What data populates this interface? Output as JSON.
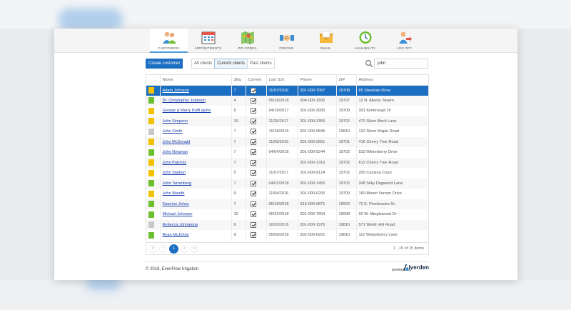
{
  "nav": [
    {
      "label": "CUSTOMERS",
      "icon": "customers-icon",
      "active": true
    },
    {
      "label": "APPOINTMENTS",
      "icon": "appointments-icon",
      "active": false
    },
    {
      "label": "ZIP-CODES",
      "icon": "map-icon",
      "active": false
    },
    {
      "label": "PRICING",
      "icon": "handshake-icon",
      "active": false
    },
    {
      "label": "EMAIL",
      "icon": "envelope-icon",
      "active": false
    },
    {
      "label": "AVAILIBILITY",
      "icon": "clock-icon",
      "active": false
    },
    {
      "label": "LOG OFF",
      "icon": "logoff-icon",
      "active": false
    }
  ],
  "toolbar": {
    "create_label": "Create customer",
    "filters": [
      "All clients",
      "Current clients",
      "Past clients"
    ],
    "active_filter": "Current clients",
    "search_value": "john"
  },
  "table": {
    "columns": [
      "",
      "Name",
      "ZEq",
      "Current",
      "Last Sch.",
      "Phone",
      "ZIP",
      "Address"
    ],
    "rows": [
      {
        "color": "#f2c200",
        "name": "Adam Johnson",
        "zeq": "7",
        "current": true,
        "last": "11/07/2016",
        "phone": "301-000-7067",
        "zip": "19708",
        "address": "85 Sheehan Drive",
        "selected": true
      },
      {
        "color": "#6cbf2e",
        "name": "Dr. Christopher Johnson",
        "zeq": "4",
        "current": true,
        "last": "05/16/2018",
        "phone": "904-000-1832",
        "zip": "19707",
        "address": "12 N. Aikens Tavern"
      },
      {
        "color": "#f2c200",
        "name": "George & Marry Ruffl ejohn",
        "zeq": "5",
        "current": true,
        "last": "04/19/2017",
        "phone": "301-000-3006",
        "zip": "19709",
        "address": "301 Kimbrough Dr"
      },
      {
        "color": "#f2c200",
        "name": "John Simpson",
        "zeq": "10",
        "current": true,
        "last": "11/20/2017",
        "phone": "301-000-3355",
        "zip": "19702",
        "address": "470 Silver Birch Lane"
      },
      {
        "color": "#c8c8c8",
        "name": "John Smith",
        "zeq": "7",
        "current": true,
        "last": "10/18/2016",
        "phone": "301-000-9845",
        "zip": "19810",
        "address": "122 Silver Maple Road"
      },
      {
        "color": "#f2c200",
        "name": "John McDonald",
        "zeq": "7",
        "current": true,
        "last": "11/03/2015",
        "phone": "301-000-2551",
        "zip": "19701",
        "address": "416 Cherry Tree Road"
      },
      {
        "color": "#6cbf2e",
        "name": "John Newman",
        "zeq": "7",
        "current": true,
        "last": "04/04/2018",
        "phone": "301-000-5244",
        "zip": "19702",
        "address": "533 Winterberry Drive"
      },
      {
        "color": "#f2c200",
        "name": "John Patricks",
        "zeq": "7",
        "current": true,
        "last": "",
        "phone": "301-000-1316",
        "zip": "19702",
        "address": "612 Cherry Tree Road"
      },
      {
        "color": "#f2c200",
        "name": "John Shelton",
        "zeq": "5",
        "current": true,
        "last": "11/07/2017",
        "phone": "301-000-9124",
        "zip": "19702",
        "address": "205 Cassina Court"
      },
      {
        "color": "#6cbf2e",
        "name": "John Tarrenberg",
        "zeq": "7",
        "current": true,
        "last": "04/02/2018",
        "phone": "301-000-1455",
        "zip": "19702",
        "address": "348 Silky Dogwood Lane"
      },
      {
        "color": "#f2c200",
        "name": "John Wealth",
        "zeq": "9",
        "current": true,
        "last": "11/04/2016",
        "phone": "301-000-6206",
        "zip": "19709",
        "address": "169 Mount Vernon Drive"
      },
      {
        "color": "#6cbf2e",
        "name": "Katerine Johns",
        "zeq": "7",
        "current": true,
        "last": "06/18/2018",
        "phone": "915-000-6871",
        "zip": "19902",
        "address": "72 E. Pembrooke Dr."
      },
      {
        "color": "#6cbf2e",
        "name": "Michael Johnson",
        "zeq": "10",
        "current": true,
        "last": "06/22/2018",
        "phone": "301-000-7654",
        "zip": "19908",
        "address": "92 W. Minglewood Dr"
      },
      {
        "color": "#c8c8c8",
        "name": "Rebecca Johnatone",
        "zeq": "6",
        "current": true,
        "last": "10/20/2016",
        "phone": "301-000-1976",
        "zip": "19810",
        "address": "571 Welsh Hill Road"
      },
      {
        "color": "#6cbf2e",
        "name": "Ryan McJohns",
        "zeq": "9",
        "current": true,
        "last": "05/08/2018",
        "phone": "302-000-6201",
        "zip": "19810",
        "address": "112 Wickerberry Lane"
      }
    ]
  },
  "pager": {
    "first": "«",
    "prev": "‹",
    "page": "1",
    "next": "›",
    "last": "»",
    "info": "1 - 15 of 15 items"
  },
  "footer": {
    "copyright": "© 2018, EvenFlow Irrigation",
    "powered_by": "powered by",
    "logo_text": "lverden"
  }
}
